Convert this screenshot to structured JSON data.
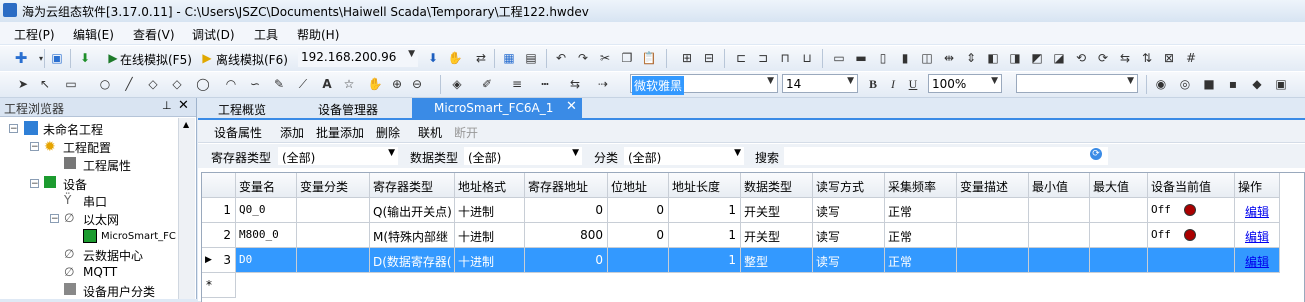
{
  "window": {
    "title": "海为云组态软件[3.17.0.11] - C:\\Users\\JSZC\\Documents\\Haiwell Scada\\Temporary\\工程122.hwdev"
  },
  "menu": [
    "工程(P)",
    "编辑(E)",
    "查看(V)",
    "调试(D)",
    "工具",
    "帮助(H)"
  ],
  "toolbar1": {
    "online_sim": "在线模拟(F5)",
    "offline_sim": "离线模拟(F6)",
    "ip": "192.168.200.96"
  },
  "toolbar2": {
    "font_name": "微软雅黑",
    "font_size": "14",
    "bold": "B",
    "italic": "I",
    "underline": "U",
    "zoom": "100%",
    "text_tool": "A"
  },
  "left_panel": {
    "title": "工程浏览器",
    "tree": [
      {
        "label": "未命名工程"
      },
      {
        "label": "工程配置"
      },
      {
        "label": "工程属性"
      },
      {
        "label": "设备"
      },
      {
        "label": "串口"
      },
      {
        "label": "以太网"
      },
      {
        "label": "MicroSmart_FC"
      },
      {
        "label": "云数据中心"
      },
      {
        "label": "MQTT"
      },
      {
        "label": "设备用户分类"
      }
    ]
  },
  "tabs": [
    "工程概览",
    "设备管理器",
    "MicroSmart_FC6A_1"
  ],
  "ops": [
    "设备属性",
    "添加",
    "批量添加",
    "删除",
    "联机",
    "断开"
  ],
  "filters": {
    "reg_type_label": "寄存器类型",
    "reg_type_value": "(全部)",
    "data_type_label": "数据类型",
    "data_type_value": "(全部)",
    "category_label": "分类",
    "category_value": "(全部)",
    "search_label": "搜索"
  },
  "columns": [
    "变量名",
    "变量分类",
    "寄存器类型",
    "地址格式",
    "寄存器地址",
    "位地址",
    "地址长度",
    "数据类型",
    "读写方式",
    "采集频率",
    "变量描述",
    "最小值",
    "最大值",
    "设备当前值",
    "操作"
  ],
  "rows": [
    {
      "num": "1",
      "name": "Q0_0",
      "cat": "",
      "reg": "Q(输出开关点)",
      "fmt": "十进制",
      "addr": "0",
      "bit": "0",
      "len": "1",
      "dtype": "开关型",
      "rw": "读写",
      "freq": "正常",
      "desc": "",
      "min": "",
      "max": "",
      "value": "Off",
      "op": "编辑"
    },
    {
      "num": "2",
      "name": "M800_0",
      "cat": "",
      "reg": "M(特殊内部继",
      "fmt": "十进制",
      "addr": "800",
      "bit": "0",
      "len": "1",
      "dtype": "开关型",
      "rw": "读写",
      "freq": "正常",
      "desc": "",
      "min": "",
      "max": "",
      "value": "Off",
      "op": "编辑"
    },
    {
      "num": "3",
      "name": "D0",
      "cat": "",
      "reg": "D(数据寄存器(",
      "fmt": "十进制",
      "addr": "0",
      "bit": "",
      "len": "1",
      "dtype": "整型",
      "rw": "读写",
      "freq": "正常",
      "desc": "",
      "min": "",
      "max": "",
      "value": "",
      "op": "编辑"
    }
  ],
  "new_row_marker": "*",
  "colors": {
    "accent": "#3a8be6",
    "selection": "#3399ff"
  }
}
